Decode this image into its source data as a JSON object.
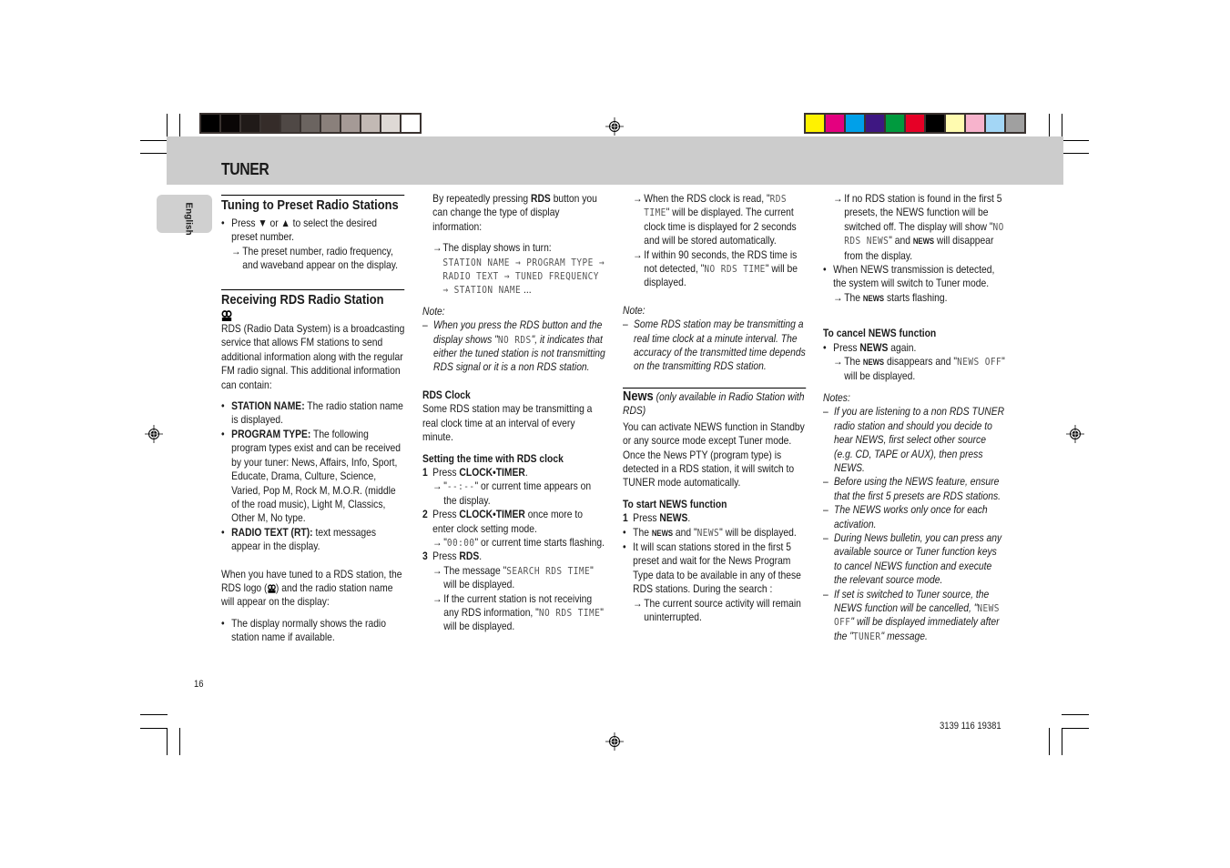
{
  "header": {
    "title": "TUNER",
    "language_tab": "English"
  },
  "colors": {
    "gray_scale": [
      "#000000",
      "#0a0606",
      "#201a18",
      "#352c29",
      "#4f4845",
      "#6b6460",
      "#8a807b",
      "#a59a96",
      "#c2b9b4",
      "#ded9d5",
      "#ffffff"
    ],
    "color_scale": [
      "#fff200",
      "#e4007f",
      "#00a0e9",
      "#3e1782",
      "#009a3e",
      "#e60026",
      "#000000",
      "#fffbb0",
      "#f7b3cc",
      "#a3d6f5",
      "#a0a0a0"
    ],
    "band": "#cccccc"
  },
  "col1": {
    "sec1_title": "Tuning to Preset Radio Stations",
    "sec1_bullet_a": "Press ▼ or ▲ to select the desired preset number.",
    "sec1_arrow": "The preset number, radio frequency, and waveband appear on the display.",
    "sec2_title": "Receiving RDS Radio Station",
    "sec2_intro": "RDS (Radio Data System) is a broadcasting service that allows FM stations to send additional information along with the regular FM radio signal. This additional information can contain:",
    "items": [
      {
        "term": "STATION NAME:",
        "text": " The radio station name is displayed."
      },
      {
        "term": "PROGRAM TYPE:",
        "text": " The following program types exist and can be received by your tuner: News, Affairs, Info, Sport, Educate, Drama, Culture, Science, Varied, Pop M, Rock M, M.O.R. (middle of the road music), Light M, Classics, Other M, No type."
      },
      {
        "term": "RADIO TEXT (RT):",
        "text": " text messages appear in the display."
      }
    ],
    "tuned_a": "When you have tuned to a RDS station, the RDS logo (",
    "tuned_b": ") and the radio station name will appear on the display:",
    "display_bullet": "The display normally shows the radio station name if available."
  },
  "col2": {
    "intro_a": "By repeatedly pressing ",
    "intro_b": "RDS",
    "intro_c": " button you can change the type of display information:",
    "arrow_text": "The display shows in turn:",
    "lcd_seq": "STATION NAME → PROGRAM TYPE → RADIO TEXT → TUNED FREQUENCY → STATION NAME",
    "lcd_tail": " ...",
    "note_label": "Note:",
    "note_a": "When you press the RDS button and the display shows \"",
    "note_lcd": "NO RDS",
    "note_b": "\", it indicates that either the tuned station is not transmitting RDS signal or it is a non RDS station.",
    "clock_title": "RDS Clock",
    "clock_text": "Some RDS station may be transmitting a real clock time at an interval of every minute.",
    "setting_title": "Setting the time with RDS clock",
    "step1_a": "Press ",
    "step1_b": "CLOCK•TIMER",
    "step1_c": ".",
    "step1_arrow_lcd": "--:--",
    "step1_arrow_text": "\" or current time appears on the display.",
    "step2_a": "Press ",
    "step2_b": "CLOCK•TIMER",
    "step2_c": " once more to enter clock setting mode.",
    "step2_arrow_lcd": "00:00",
    "step2_arrow_text": "\" or current time starts flashing.",
    "step3_a": "Press ",
    "step3_b": "RDS",
    "step3_c": ".",
    "step3_arrow1_a": "The message \"",
    "step3_arrow1_lcd": "SEARCH RDS TIME",
    "step3_arrow1_b": "\" will be displayed.",
    "step3_arrow2_a": "If the current station is not receiving any RDS information, \"",
    "step3_arrow2_lcd": "NO RDS TIME",
    "step3_arrow2_b": "\" will be displayed.",
    "step_nums": [
      "1",
      "2",
      "3"
    ]
  },
  "col3": {
    "arrow1_a": "When the RDS clock is read, \"",
    "arrow1_lcd": "RDS TIME",
    "arrow1_b": "\" will be displayed.  The current clock time is displayed for 2 seconds and will be stored automatically.",
    "arrow2_a": "If within 90 seconds, the RDS time is not detected, \"",
    "arrow2_lcd": "NO RDS TIME",
    "arrow2_b": "\" will be displayed.",
    "note_label": "Note:",
    "note_text": "Some RDS station may be transmitting a real time clock at a minute interval.  The accuracy of the transmitted time depends on the transmitting RDS station.",
    "news_title": "News",
    "news_sub": " (only available in Radio Station with RDS)",
    "news_intro": "You can activate NEWS function in Standby or any source mode except Tuner mode. Once the News PTY (program type) is detected in a RDS station, it will switch to TUNER mode automatically.",
    "start_title": "To start NEWS function",
    "start_step_num": "1",
    "start_step_a": "Press ",
    "start_step_b": "NEWS",
    "start_step_c": ".",
    "bullet1_a": "The ",
    "bullet1_sc": "NEWS",
    "bullet1_b": " and \"",
    "bullet1_lcd": "NEWS",
    "bullet1_c": "\" will be displayed.",
    "bullet2": "It will scan stations stored in the first 5 preset and wait for the News Program Type data to be available in any of these RDS stations.  During the search :",
    "bullet2_arrow": "The current source activity will remain uninterrupted."
  },
  "col4": {
    "arrow1_a": "If no RDS station is found in the first 5 presets, the NEWS function will be switched off.  The display will show \"",
    "arrow1_lcd": "NO RDS NEWS",
    "arrow1_b": "\" and ",
    "arrow1_sc": "NEWS",
    "arrow1_c": " will disappear from the display.",
    "bullet_a": "When NEWS transmission is detected, the system will switch to Tuner mode.",
    "bullet_arrow_a": "The ",
    "bullet_arrow_sc": "NEWS",
    "bullet_arrow_b": " starts flashing.",
    "cancel_title": "To cancel NEWS function",
    "cancel_a": "Press ",
    "cancel_b": "NEWS",
    "cancel_c": " again.",
    "cancel_arrow_a": "The ",
    "cancel_arrow_sc": "NEWS",
    "cancel_arrow_b": " disappears and \"",
    "cancel_arrow_lcd": "NEWS OFF",
    "cancel_arrow_c": "\" will be displayed.",
    "notes_label": "Notes:",
    "notes": [
      "If you are listening to a non RDS TUNER radio station and should you decide to hear NEWS, first select other source (e.g. CD, TAPE or AUX), then press NEWS.",
      "Before using the NEWS feature, ensure that the first 5 presets are RDS stations.",
      "The NEWS works only once for each activation.",
      "During News bulletin, you can press any available source or Tuner function keys to cancel NEWS function and execute the relevant source mode."
    ],
    "note5_a": "If set is switched to Tuner source, the NEWS function will be cancelled, \"",
    "note5_lcd": "NEWS OFF",
    "note5_b": "\" will be displayed immediately after the \"",
    "note5_lcd2": "TUNER",
    "note5_c": "\" message."
  },
  "footer": {
    "page_number": "16",
    "doc_code": "3139 116 19381"
  },
  "glyphs": {
    "bullet": "•",
    "arrow": "→",
    "dash": "–",
    "quote": "\""
  }
}
